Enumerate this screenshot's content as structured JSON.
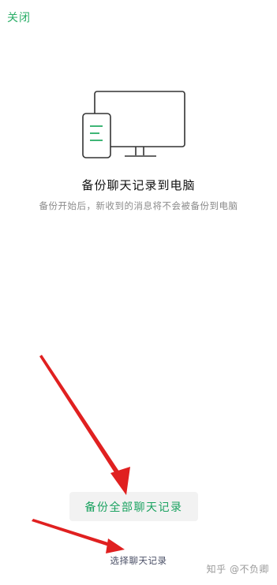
{
  "header": {
    "close_label": "关闭"
  },
  "hero": {
    "icon": "monitor-phone-icon",
    "title": "备份聊天记录到电脑",
    "subtitle": "备份开始后，新收到的消息将不会被备份到电脑"
  },
  "actions": {
    "backup_all_label": "备份全部聊天记录",
    "select_chats_label": "选择聊天记录"
  },
  "overlay": {
    "watermark": "知乎 @不负卿"
  },
  "colors": {
    "accent": "#2aae67",
    "button_bg": "#f2f2f2",
    "annotation_arrow": "#e02020"
  }
}
